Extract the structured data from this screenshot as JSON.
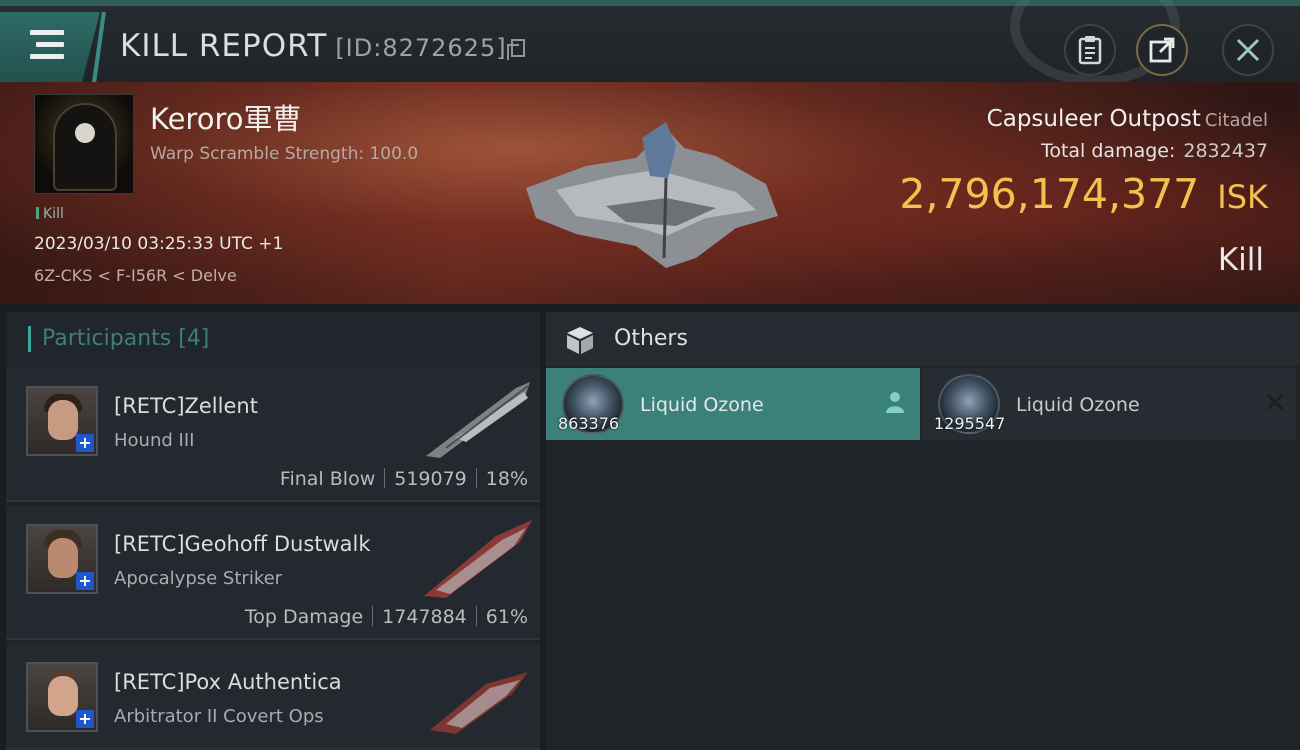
{
  "header": {
    "title": "KILL REPORT",
    "id_label": "[ID:8272625]",
    "icons": [
      "menu-icon",
      "clipboard-icon",
      "share-icon",
      "close-icon"
    ]
  },
  "victim": {
    "pilot_name": "Keroro軍曹",
    "scramble": "Warp Scramble Strength: 100.0",
    "tag": "Kill",
    "datetime": "2023/03/10 03:25:33 UTC +1",
    "location": "6Z-CKS < F-I56R < Delve",
    "ship_name": "Capsuleer Outpost",
    "ship_class": "Citadel",
    "total_damage_label": "Total damage:",
    "total_damage": "2832437",
    "isk_value": "2,796,174,377",
    "isk_unit": "ISK",
    "outcome": "Kill"
  },
  "participants": {
    "label": "Participants [4]",
    "rows": [
      {
        "name": "[RETC]Zellent",
        "ship": "Hound III",
        "role": "Final Blow",
        "damage": "519079",
        "percent": "18%"
      },
      {
        "name": "[RETC]Geohoff Dustwalk",
        "ship": "Apocalypse Striker",
        "role": "Top Damage",
        "damage": "1747884",
        "percent": "61%"
      },
      {
        "name": "[RETC]Pox Authentica",
        "ship": "Arbitrator II Covert Ops"
      }
    ]
  },
  "others": {
    "label": "Others",
    "items": [
      {
        "name": "Liquid Ozone",
        "quantity": "863376",
        "icon": "person-icon"
      },
      {
        "name": "Liquid Ozone",
        "quantity": "1295547",
        "icon": "x-icon"
      }
    ]
  },
  "colors": {
    "accent": "#3aa59a",
    "isk": "#f2c14e",
    "selected_item": "#3c807a"
  }
}
